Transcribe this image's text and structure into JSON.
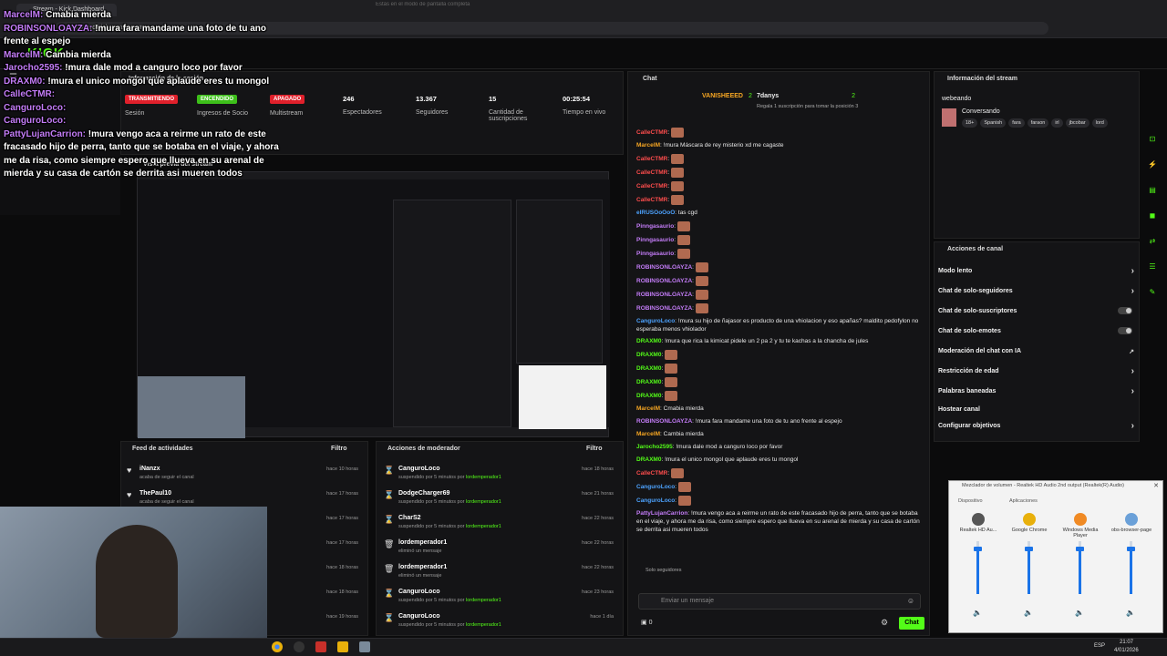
{
  "browser": {
    "tab_title": "Stream - Kick Dashboard",
    "url": "dashboard.kick.com/stream",
    "popup_text": "Estás en el modo de pantalla completa"
  },
  "header": {
    "logo": "KICK"
  },
  "session": {
    "title": "Información de la sesión",
    "stats": [
      {
        "badge": "TRANSMITIENDO",
        "label": "Sesión",
        "color": "#e0202b"
      },
      {
        "badge": "ENCENDIDO",
        "label": "Ingresos de Socio",
        "color": "#3dbf1a"
      },
      {
        "badge": "APAGADO",
        "label": "Multistream",
        "color": "#e0202b"
      },
      {
        "value": "246",
        "label": "Espectadores"
      },
      {
        "value": "13.367",
        "label": "Seguidores"
      },
      {
        "value": "15",
        "label": "Cantidad de suscripciones"
      },
      {
        "value": "00:25:54",
        "label": "Tiempo en vivo"
      }
    ]
  },
  "preview": {
    "title": "Vista previa del stream"
  },
  "feed": {
    "title": "Feed de actividades",
    "filter": "Filtro",
    "rows": [
      {
        "name": "iNanzx",
        "sub": "acaba de seguir el canal",
        "time": "hace 10 horas"
      },
      {
        "name": "ThePaul10",
        "sub": "acaba de seguir el canal",
        "time": "hace 17 horas"
      },
      {
        "name": "",
        "sub": "",
        "time": "hace 17 horas"
      },
      {
        "name": "",
        "sub": "",
        "time": "hace 17 horas"
      },
      {
        "name": "",
        "sub": "",
        "time": "hace 18 horas"
      },
      {
        "name": "",
        "sub": "",
        "time": "hace 18 horas"
      },
      {
        "name": "",
        "sub": "",
        "time": "hace 19 horas"
      }
    ]
  },
  "mod": {
    "title": "Acciones de moderador",
    "filter": "Filtro",
    "by": "lordemperador1",
    "rows": [
      {
        "icon": "⌛",
        "name": "CanguroLoco",
        "sub": "suspendido por 5 minutos por",
        "time": "hace 18 horas"
      },
      {
        "icon": "⌛",
        "name": "DodgeCharger69",
        "sub": "suspendido por 5 minutos por",
        "time": "hace 21 horas"
      },
      {
        "icon": "⌛",
        "name": "CharS2",
        "sub": "suspendido por 5 minutos por",
        "time": "hace 22 horas"
      },
      {
        "icon": "🗑",
        "name": "lordemperador1",
        "sub": "eliminó un mensaje",
        "time": "hace 22 horas"
      },
      {
        "icon": "🗑",
        "name": "lordemperador1",
        "sub": "eliminó un mensaje",
        "time": "hace 22 horas"
      },
      {
        "icon": "⌛",
        "name": "CanguroLoco",
        "sub": "suspendido por 5 minutos por",
        "time": "hace 23 horas"
      },
      {
        "icon": "⌛",
        "name": "CanguroLoco",
        "sub": "suspendido por 5 minutos por",
        "time": "hace 1 día"
      }
    ]
  },
  "chat": {
    "title": "Chat",
    "top1": "VANISHEEED",
    "top1_count": "2",
    "top2": "7danys",
    "top2_count": "2",
    "gift_note": "Regala 1 suscripción para tomar la posición 3",
    "messages": [
      {
        "user": "CalleCTMR",
        "color": "#ff4d4d",
        "text": "",
        "emote": true
      },
      {
        "user": "MarcelM",
        "color": "#f6a623",
        "text": "!mura Máscara de rey misterio xd me cagaste",
        "emote": false
      },
      {
        "user": "CalleCTMR",
        "color": "#ff4d4d",
        "text": "",
        "emote": true
      },
      {
        "user": "CalleCTMR",
        "color": "#ff4d4d",
        "text": "",
        "emote": true
      },
      {
        "user": "CalleCTMR",
        "color": "#ff4d4d",
        "text": "",
        "emote": true
      },
      {
        "user": "CalleCTMR",
        "color": "#ff4d4d",
        "text": "",
        "emote": true
      },
      {
        "user": "elRUSOoOoO",
        "color": "#4da3ff",
        "text": "tas cgd",
        "emote": false
      },
      {
        "user": "Pinngasaurio",
        "color": "#c37cf7",
        "text": "",
        "emote": true
      },
      {
        "user": "Pinngasaurio",
        "color": "#c37cf7",
        "text": "",
        "emote": true
      },
      {
        "user": "Pinngasaurio",
        "color": "#c37cf7",
        "text": "",
        "emote": true
      },
      {
        "user": "ROBINSONLOAYZA",
        "color": "#c37cf7",
        "text": "",
        "emote": true
      },
      {
        "user": "ROBINSONLOAYZA",
        "color": "#c37cf7",
        "text": "",
        "emote": true
      },
      {
        "user": "ROBINSONLOAYZA",
        "color": "#c37cf7",
        "text": "",
        "emote": true
      },
      {
        "user": "ROBINSONLOAYZA",
        "color": "#c37cf7",
        "text": "",
        "emote": true
      },
      {
        "user": "CanguroLoco",
        "color": "#4da3ff",
        "text": "!mura su hijo de ñajasor es producto de una vhiolacion y eso apañas? maldito pedofylon no esperaba menos vhiolador",
        "emote": false
      },
      {
        "user": "DRAXM0",
        "color": "#53fc18",
        "text": "!mura que rica la kimicat pidele un 2 pa 2 y tu te kachas a la chancha de jules",
        "emote": false
      },
      {
        "user": "DRAXM0",
        "color": "#53fc18",
        "text": "",
        "emote": true
      },
      {
        "user": "DRAXM0",
        "color": "#53fc18",
        "text": "",
        "emote": true
      },
      {
        "user": "DRAXM0",
        "color": "#53fc18",
        "text": "",
        "emote": true
      },
      {
        "user": "DRAXM0",
        "color": "#53fc18",
        "text": "",
        "emote": true
      },
      {
        "user": "MarcelM",
        "color": "#f6a623",
        "text": "Cmabia mierda",
        "emote": false
      },
      {
        "user": "ROBINSONLOAYZA",
        "color": "#c37cf7",
        "text": "!mura fara mandame una foto de tu ano frente al espejo",
        "emote": false
      },
      {
        "user": "MarcelM",
        "color": "#f6a623",
        "text": "Cambia mierda",
        "emote": false
      },
      {
        "user": "Jarocho2595",
        "color": "#53fc18",
        "text": "!mura dale mod a canguro loco por favor",
        "emote": false
      },
      {
        "user": "DRAXM0",
        "color": "#53fc18",
        "text": "!mura el unico mongol que aplaude eres tu mongol",
        "emote": false
      },
      {
        "user": "CalleCTMR",
        "color": "#ff4d4d",
        "text": "",
        "emote": true
      },
      {
        "user": "CanguroLoco",
        "color": "#4da3ff",
        "text": "",
        "emote": true
      },
      {
        "user": "CanguroLoco",
        "color": "#4da3ff",
        "text": "",
        "emote": true
      },
      {
        "user": "PattyLujanCarrion",
        "color": "#c37cf7",
        "text": "!mura vengo aca a reirme un rato de este fracasado hijo de perra, tanto que se botaba en el viaje, y ahora me da risa, como siempre espero que llueva en su arenal de mierda y su casa de cartón se derrita asi mueren todos",
        "emote": false
      }
    ],
    "followers_only": "Solo seguidores",
    "input_placeholder": "Enviar un mensaje",
    "count": "0",
    "send_label": "Chat"
  },
  "stream_info": {
    "title": "Información del stream",
    "stream_title": "webeando",
    "category": "Conversando",
    "tags": [
      "18+",
      "Spanish",
      "fara",
      "faraon",
      "irl",
      "jbcobar",
      "lord"
    ]
  },
  "channel_actions": {
    "title": "Acciones de canal",
    "items": [
      {
        "label": "Modo lento",
        "kind": "chevron"
      },
      {
        "label": "Chat de solo-seguidores",
        "kind": "chevron"
      },
      {
        "label": "Chat de solo-suscriptores",
        "kind": "toggle"
      },
      {
        "label": "Chat de solo-emotes",
        "kind": "toggle"
      },
      {
        "label": "Moderación del chat con IA",
        "kind": "ext"
      },
      {
        "label": "Restricción de edad",
        "kind": "chevron"
      },
      {
        "label": "Palabras baneadas",
        "kind": "chevron"
      },
      {
        "label": "Hostear canal",
        "kind": "none"
      },
      {
        "label": "Configurar objetivos",
        "kind": "chevron"
      }
    ]
  },
  "overlay": {
    "lines": [
      {
        "user": "MarcelM:",
        "text": "Cmabia mierda"
      },
      {
        "user": "ROBINSONLOAYZA:",
        "text": "!mura fara mandame una foto de tu ano frente al espejo"
      },
      {
        "user": "MarcelM:",
        "text": "Cambia mierda"
      },
      {
        "user": "Jarocho2595:",
        "text": "!mura dale mod a canguro loco por favor"
      },
      {
        "user": "DRAXM0:",
        "text": "!mura el unico mongol que aplaude eres tu mongol"
      },
      {
        "user": "CalleCTMR:",
        "text": ""
      },
      {
        "user": "CanguroLoco:",
        "text": ""
      },
      {
        "user": "CanguroLoco:",
        "text": ""
      },
      {
        "user": "PattyLujanCarrion:",
        "text": "!mura vengo aca a reirme un rato de este fracasado hijo de perra, tanto que se botaba en el viaje, y ahora me da risa, como siempre espero que llueva en su arenal de mierda y su casa de cartón se derrita asi mueren todos"
      }
    ]
  },
  "mixer": {
    "title": "Mezclador de volumen - Realtek HD Audio 2nd output (Realtek(R) Audio)",
    "device_label": "Dispositivo",
    "apps_label": "Aplicaciones",
    "columns": [
      {
        "name": "Realtek HD Au...",
        "icon_color": "#555555",
        "level": 0.86
      },
      {
        "name": "Google Chrome",
        "icon_color": "#e8b00b",
        "level": 0.86
      },
      {
        "name": "Windows Media Player",
        "icon_color": "#f08a24",
        "level": 0.86
      },
      {
        "name": "obs-browser-page",
        "icon_color": "#6aa0d8",
        "level": 0.86
      }
    ]
  },
  "taskbar": {
    "time": "21:07",
    "date": "4/01/2026",
    "lang": "ESP"
  },
  "colors": {
    "accent": "#53fc18",
    "live": "#e0202b"
  }
}
